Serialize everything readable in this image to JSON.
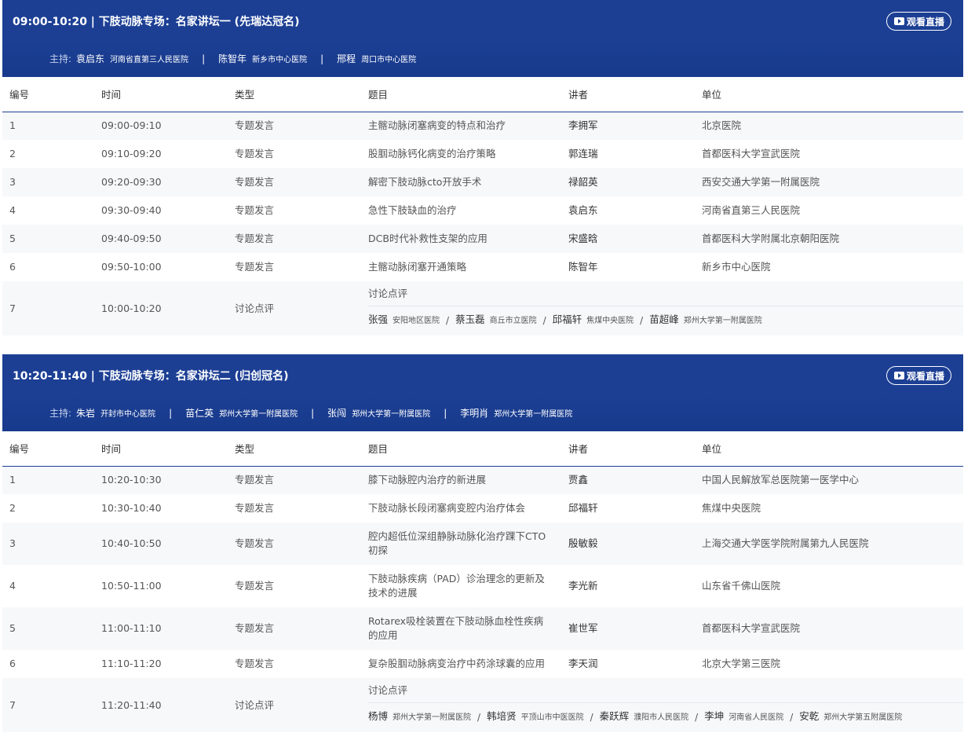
{
  "watch_label": "观看直播",
  "columns": [
    "编号",
    "时间",
    "类型",
    "题目",
    "讲者",
    "单位"
  ],
  "sessions": [
    {
      "title": "09:00-10:20 | 下肢动脉专场：名家讲坛一 (先瑞达冠名)",
      "hosts_prefix": "主持:",
      "hosts": [
        {
          "name": "袁启东",
          "unit": "河南省直第三人民医院"
        },
        {
          "name": "陈智年",
          "unit": "新乡市中心医院"
        },
        {
          "name": "邢程",
          "unit": "周口市中心医院"
        }
      ],
      "rows": [
        {
          "no": "1",
          "time": "09:00-09:10",
          "type": "专题发言",
          "topic": "主髂动脉闭塞病变的特点和治疗",
          "speaker": "李拥军",
          "unit": "北京医院",
          "h": 36
        },
        {
          "no": "2",
          "time": "09:10-09:20",
          "type": "专题发言",
          "topic": "股腘动脉钙化病变的治疗策略",
          "speaker": "郭连瑞",
          "unit": "首都医科大学宣武医院",
          "h": 36
        },
        {
          "no": "3",
          "time": "09:20-09:30",
          "type": "专题发言",
          "topic": "解密下肢动脉cto开放手术",
          "speaker": "禄韶英",
          "unit": "西安交通大学第一附属医院",
          "h": 36
        },
        {
          "no": "4",
          "time": "09:30-09:40",
          "type": "专题发言",
          "topic": "急性下肢缺血的治疗",
          "speaker": "袁启东",
          "unit": "河南省直第三人民医院",
          "h": 36
        },
        {
          "no": "5",
          "time": "09:40-09:50",
          "type": "专题发言",
          "topic": "DCB时代补救性支架的应用",
          "speaker": "宋盛晗",
          "unit": "首都医科大学附属北京朝阳医院",
          "h": 36
        },
        {
          "no": "6",
          "time": "09:50-10:00",
          "type": "专题发言",
          "topic": "主髂动脉闭塞开通策略",
          "speaker": "陈智年",
          "unit": "新乡市中心医院",
          "h": 36
        }
      ],
      "discussion": {
        "no": "7",
        "time": "10:00-10:20",
        "type": "讨论点评",
        "topic": "讨论点评",
        "speakers": [
          {
            "name": "张强",
            "unit": "安阳地区医院"
          },
          {
            "name": "蔡玉磊",
            "unit": "商丘市立医院"
          },
          {
            "name": "邱福轩",
            "unit": "焦煤中央医院"
          },
          {
            "name": "苗超峰",
            "unit": "郑州大学第一附属医院"
          }
        ]
      }
    },
    {
      "title": "10:20-11:40 | 下肢动脉专场：名家讲坛二 (归创冠名)",
      "hosts_prefix": "主持:",
      "hosts": [
        {
          "name": "朱岩",
          "unit": "开封市中心医院"
        },
        {
          "name": "苗仁英",
          "unit": "郑州大学第一附属医院"
        },
        {
          "name": "张闯",
          "unit": "郑州大学第一附属医院"
        },
        {
          "name": "李明肖",
          "unit": "郑州大学第一附属医院"
        }
      ],
      "rows": [
        {
          "no": "1",
          "time": "10:20-10:30",
          "type": "专题发言",
          "topic": "膝下动脉腔内治疗的新进展",
          "speaker": "贾鑫",
          "unit": "中国人民解放军总医院第一医学中心",
          "h": 36
        },
        {
          "no": "2",
          "time": "10:30-10:40",
          "type": "专题发言",
          "topic": "下肢动脉长段闭塞病变腔内治疗体会",
          "speaker": "邱福轩",
          "unit": "焦煤中央医院",
          "h": 36
        },
        {
          "no": "3",
          "time": "10:40-10:50",
          "type": "专题发言",
          "topic": "腔内超低位深组静脉动脉化治疗踝下CTO初探",
          "speaker": "殷敏毅",
          "unit": "上海交通大学医学院附属第九人民医院",
          "h": 54
        },
        {
          "no": "4",
          "time": "10:50-11:00",
          "type": "专题发言",
          "topic": "下肢动脉疾病（PAD）诊治理念的更新及技术的进展",
          "speaker": "李光新",
          "unit": "山东省千佛山医院",
          "h": 54
        },
        {
          "no": "5",
          "time": "11:00-11:10",
          "type": "专题发言",
          "topic": "Rotarex吸栓装置在下肢动脉血栓性疾病的应用",
          "speaker": "崔世军",
          "unit": "首都医科大学宣武医院",
          "h": 54
        },
        {
          "no": "6",
          "time": "11:10-11:20",
          "type": "专题发言",
          "topic": "复杂股腘动脉病变治疗中药涂球囊的应用",
          "speaker": "李天润",
          "unit": "北京大学第三医院",
          "h": 36
        }
      ],
      "discussion": {
        "no": "7",
        "time": "11:20-11:40",
        "type": "讨论点评",
        "topic": "讨论点评",
        "speakers": [
          {
            "name": "杨博",
            "unit": "郑州大学第一附属医院"
          },
          {
            "name": "韩培贤",
            "unit": "平顶山市中医医院"
          },
          {
            "name": "秦跃辉",
            "unit": "濮阳市人民医院"
          },
          {
            "name": "李坤",
            "unit": "河南省人民医院"
          },
          {
            "name": "安乾",
            "unit": "郑州大学第五附属医院"
          }
        ]
      }
    }
  ]
}
